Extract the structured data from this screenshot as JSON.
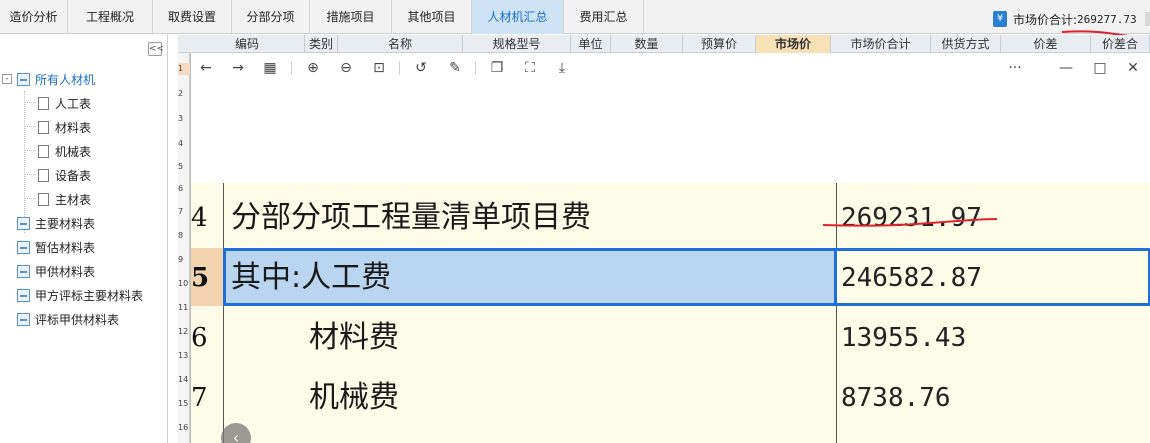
{
  "tabs": [
    {
      "label": "造价分析",
      "active": false
    },
    {
      "label": "工程概况",
      "active": false
    },
    {
      "label": "取费设置",
      "active": false
    },
    {
      "label": "分部分项",
      "active": false
    },
    {
      "label": "措施项目",
      "active": false
    },
    {
      "label": "其他项目",
      "active": false
    },
    {
      "label": "人材机汇总",
      "active": true
    },
    {
      "label": "费用汇总",
      "active": false
    }
  ],
  "summary": {
    "label": "市场价合计:",
    "value": "269277.73",
    "icon": "yen-icon"
  },
  "colors": {
    "accent": "#1a6fc4",
    "selection_border": "#1e6fd9",
    "selection_fill": "#b9d5f0",
    "annotation_red": "#e0202a",
    "photo_bg": "#fdfce8"
  },
  "tree": {
    "collapse_label": "<<",
    "root": {
      "label": "所有人材机",
      "expanded": "-"
    },
    "children": [
      "人工表",
      "材料表",
      "机械表",
      "设备表",
      "主材表"
    ],
    "others": [
      "主要材料表",
      "暂估材料表",
      "甲供材料表",
      "甲方评标主要材料表",
      "评标甲供材料表"
    ]
  },
  "grid": {
    "headers": [
      "编码",
      "类别",
      "名称",
      "规格型号",
      "单位",
      "数量",
      "预算价",
      "市场价",
      "市场价合计",
      "供货方式",
      "价差",
      "价差合"
    ],
    "row_numbers": [
      "1",
      "2",
      "3",
      "4",
      "5",
      "6",
      "7",
      "8",
      "9",
      "10",
      "11",
      "12",
      "13",
      "14",
      "15",
      "16"
    ]
  },
  "viewer": {
    "toolbar": {
      "back": "←",
      "forward": "→",
      "grid": "▦",
      "zoom_in": "⊕",
      "zoom_out": "⊖",
      "fit": "⊡",
      "rotate": "↺",
      "edit": "✎",
      "copy": "❐",
      "crop": "⛶",
      "download": "⤓",
      "more": "···",
      "minimize": "—",
      "maximize": "□",
      "close": "✕"
    },
    "nav_prev": "‹",
    "photo_rows": [
      {
        "num": "4",
        "text": "分部分项工程量清单项目费",
        "value": "269231.97"
      },
      {
        "num": "5",
        "text": "其中:人工费",
        "value": "246582.87"
      },
      {
        "num": "6",
        "text": "材料费",
        "value": "13955.43"
      },
      {
        "num": "7",
        "text": "机械费",
        "value": "8738.76"
      }
    ]
  }
}
